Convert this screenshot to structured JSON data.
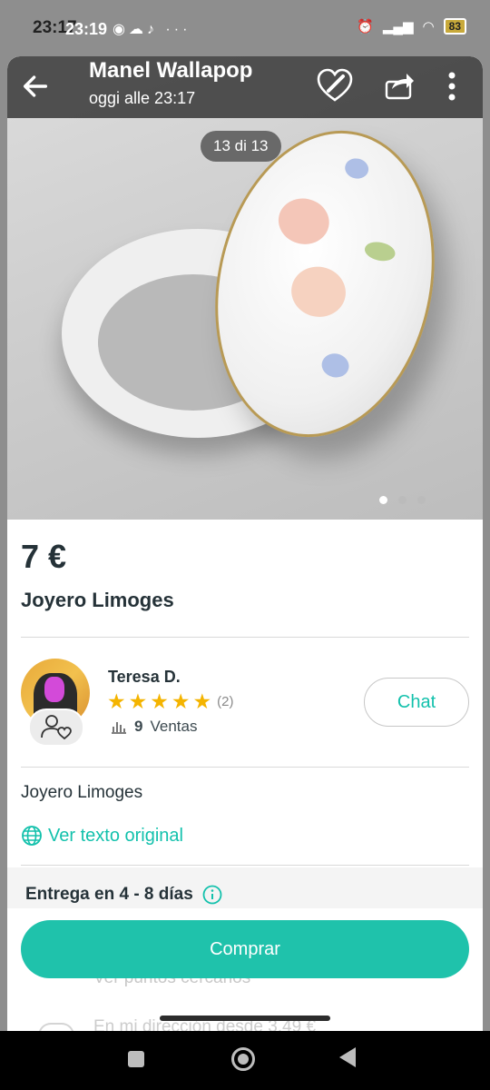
{
  "status_bar": {
    "time_dark": "23:17",
    "time": "23:19",
    "battery": "83"
  },
  "header": {
    "title": "Manel Wallapop",
    "subtitle": "oggi alle 23:17"
  },
  "gallery": {
    "counter": "13 di 13",
    "total_dots": 3,
    "active_dot": 1
  },
  "product": {
    "price": "7 €",
    "title": "Joyero Limoges",
    "description": "Joyero Limoges",
    "translate_link": "Ver texto original"
  },
  "seller": {
    "name": "Teresa D.",
    "rating": 5,
    "reviews": "(2)",
    "sales_count": "9",
    "sales_label": "Ventas",
    "chat_label": "Chat"
  },
  "delivery": {
    "label": "Entrega en 4 - 8 días",
    "option_pickup": "Ver puntos cercanos",
    "option_home": "En mi dirección desde 3,49 €"
  },
  "actions": {
    "buy_label": "Comprar"
  },
  "colors": {
    "accent": "#13c1ac",
    "buy_button": "#1fc2ab",
    "star": "#f4b400"
  }
}
